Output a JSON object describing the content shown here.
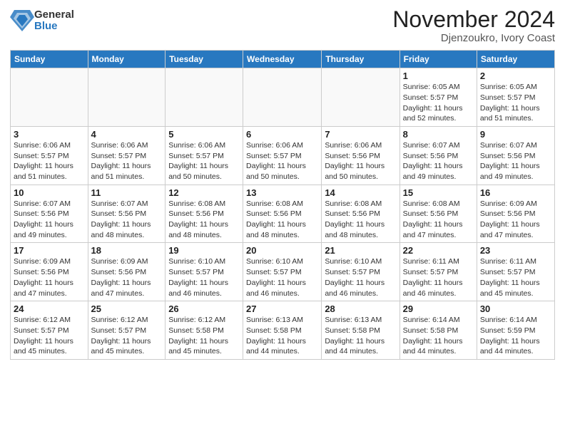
{
  "header": {
    "logo_general": "General",
    "logo_blue": "Blue",
    "title": "November 2024",
    "subtitle": "Djenzoukro, Ivory Coast"
  },
  "calendar": {
    "days_of_week": [
      "Sunday",
      "Monday",
      "Tuesday",
      "Wednesday",
      "Thursday",
      "Friday",
      "Saturday"
    ],
    "weeks": [
      [
        {
          "day": "",
          "empty": true
        },
        {
          "day": "",
          "empty": true
        },
        {
          "day": "",
          "empty": true
        },
        {
          "day": "",
          "empty": true
        },
        {
          "day": "",
          "empty": true
        },
        {
          "day": "1",
          "sunrise": "6:05 AM",
          "sunset": "5:57 PM",
          "daylight": "11 hours and 52 minutes."
        },
        {
          "day": "2",
          "sunrise": "6:05 AM",
          "sunset": "5:57 PM",
          "daylight": "11 hours and 51 minutes."
        }
      ],
      [
        {
          "day": "3",
          "sunrise": "6:06 AM",
          "sunset": "5:57 PM",
          "daylight": "11 hours and 51 minutes."
        },
        {
          "day": "4",
          "sunrise": "6:06 AM",
          "sunset": "5:57 PM",
          "daylight": "11 hours and 51 minutes."
        },
        {
          "day": "5",
          "sunrise": "6:06 AM",
          "sunset": "5:57 PM",
          "daylight": "11 hours and 50 minutes."
        },
        {
          "day": "6",
          "sunrise": "6:06 AM",
          "sunset": "5:57 PM",
          "daylight": "11 hours and 50 minutes."
        },
        {
          "day": "7",
          "sunrise": "6:06 AM",
          "sunset": "5:56 PM",
          "daylight": "11 hours and 50 minutes."
        },
        {
          "day": "8",
          "sunrise": "6:07 AM",
          "sunset": "5:56 PM",
          "daylight": "11 hours and 49 minutes."
        },
        {
          "day": "9",
          "sunrise": "6:07 AM",
          "sunset": "5:56 PM",
          "daylight": "11 hours and 49 minutes."
        }
      ],
      [
        {
          "day": "10",
          "sunrise": "6:07 AM",
          "sunset": "5:56 PM",
          "daylight": "11 hours and 49 minutes."
        },
        {
          "day": "11",
          "sunrise": "6:07 AM",
          "sunset": "5:56 PM",
          "daylight": "11 hours and 48 minutes."
        },
        {
          "day": "12",
          "sunrise": "6:08 AM",
          "sunset": "5:56 PM",
          "daylight": "11 hours and 48 minutes."
        },
        {
          "day": "13",
          "sunrise": "6:08 AM",
          "sunset": "5:56 PM",
          "daylight": "11 hours and 48 minutes."
        },
        {
          "day": "14",
          "sunrise": "6:08 AM",
          "sunset": "5:56 PM",
          "daylight": "11 hours and 48 minutes."
        },
        {
          "day": "15",
          "sunrise": "6:08 AM",
          "sunset": "5:56 PM",
          "daylight": "11 hours and 47 minutes."
        },
        {
          "day": "16",
          "sunrise": "6:09 AM",
          "sunset": "5:56 PM",
          "daylight": "11 hours and 47 minutes."
        }
      ],
      [
        {
          "day": "17",
          "sunrise": "6:09 AM",
          "sunset": "5:56 PM",
          "daylight": "11 hours and 47 minutes."
        },
        {
          "day": "18",
          "sunrise": "6:09 AM",
          "sunset": "5:56 PM",
          "daylight": "11 hours and 47 minutes."
        },
        {
          "day": "19",
          "sunrise": "6:10 AM",
          "sunset": "5:57 PM",
          "daylight": "11 hours and 46 minutes."
        },
        {
          "day": "20",
          "sunrise": "6:10 AM",
          "sunset": "5:57 PM",
          "daylight": "11 hours and 46 minutes."
        },
        {
          "day": "21",
          "sunrise": "6:10 AM",
          "sunset": "5:57 PM",
          "daylight": "11 hours and 46 minutes."
        },
        {
          "day": "22",
          "sunrise": "6:11 AM",
          "sunset": "5:57 PM",
          "daylight": "11 hours and 46 minutes."
        },
        {
          "day": "23",
          "sunrise": "6:11 AM",
          "sunset": "5:57 PM",
          "daylight": "11 hours and 45 minutes."
        }
      ],
      [
        {
          "day": "24",
          "sunrise": "6:12 AM",
          "sunset": "5:57 PM",
          "daylight": "11 hours and 45 minutes."
        },
        {
          "day": "25",
          "sunrise": "6:12 AM",
          "sunset": "5:57 PM",
          "daylight": "11 hours and 45 minutes."
        },
        {
          "day": "26",
          "sunrise": "6:12 AM",
          "sunset": "5:58 PM",
          "daylight": "11 hours and 45 minutes."
        },
        {
          "day": "27",
          "sunrise": "6:13 AM",
          "sunset": "5:58 PM",
          "daylight": "11 hours and 44 minutes."
        },
        {
          "day": "28",
          "sunrise": "6:13 AM",
          "sunset": "5:58 PM",
          "daylight": "11 hours and 44 minutes."
        },
        {
          "day": "29",
          "sunrise": "6:14 AM",
          "sunset": "5:58 PM",
          "daylight": "11 hours and 44 minutes."
        },
        {
          "day": "30",
          "sunrise": "6:14 AM",
          "sunset": "5:59 PM",
          "daylight": "11 hours and 44 minutes."
        }
      ]
    ],
    "labels": {
      "sunrise": "Sunrise:",
      "sunset": "Sunset:",
      "daylight": "Daylight:"
    }
  }
}
